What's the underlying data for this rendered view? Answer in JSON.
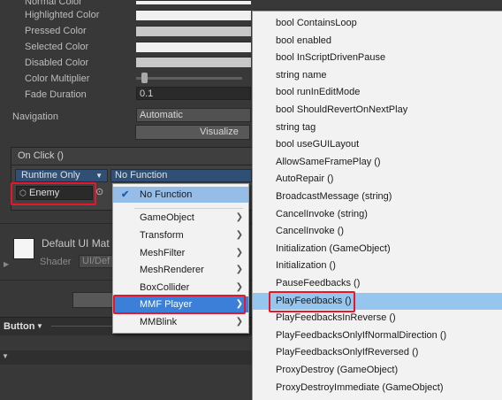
{
  "inspector": {
    "colors": [
      {
        "label": "Normal Color"
      },
      {
        "label": "Highlighted Color"
      },
      {
        "label": "Pressed Color"
      },
      {
        "label": "Selected Color"
      },
      {
        "label": "Disabled Color"
      }
    ],
    "color_multiplier_label": "Color Multiplier",
    "fade_duration_label": "Fade Duration",
    "fade_duration_value": "0.1",
    "navigation_label": "Navigation",
    "navigation_value": "Automatic",
    "visualize_label": "Visualize",
    "onclick_label": "On Click ()",
    "runtime_value": "Runtime Only",
    "function_value": "No Function",
    "object_value": "Enemy",
    "material_name": "Default UI Mat",
    "shader_label": "Shader",
    "shader_value": "UI/Def",
    "button_label": "Button"
  },
  "left_menu": {
    "items": [
      {
        "label": "No Function",
        "checked": true
      },
      {
        "label": "GameObject",
        "submenu": true
      },
      {
        "label": "Transform",
        "submenu": true
      },
      {
        "label": "MeshFilter",
        "submenu": true
      },
      {
        "label": "MeshRenderer",
        "submenu": true
      },
      {
        "label": "BoxCollider",
        "submenu": true
      },
      {
        "label": "MMF Player",
        "submenu": true,
        "highlighted": true
      },
      {
        "label": "MMBlink",
        "submenu": true
      }
    ]
  },
  "right_menu": {
    "items": [
      "bool ContainsLoop",
      "bool enabled",
      "bool InScriptDrivenPause",
      "string name",
      "bool runInEditMode",
      "bool ShouldRevertOnNextPlay",
      "string tag",
      "bool useGUILayout",
      "AllowSameFramePlay ()",
      "AutoRepair ()",
      "BroadcastMessage (string)",
      "CancelInvoke (string)",
      "CancelInvoke ()",
      "Initialization (GameObject)",
      "Initialization ()",
      "PauseFeedbacks ()",
      "PlayFeedbacks ()",
      "PlayFeedbacksInReverse ()",
      "PlayFeedbacksOnlyIfNormalDirection ()",
      "PlayFeedbacksOnlyIfReversed ()",
      "ProxyDestroy (GameObject)",
      "ProxyDestroyImmediate (GameObject)"
    ],
    "highlighted_index": 16
  },
  "accent_colors": {
    "highlight_red_box": "#e8162a",
    "menu_hover": "#96bde8",
    "menu_selected": "#3c7fd8"
  }
}
